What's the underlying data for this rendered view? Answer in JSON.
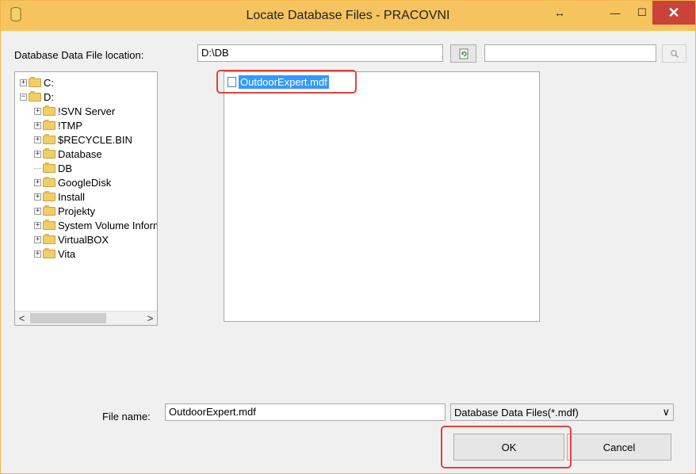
{
  "window": {
    "title": "Locate Database Files - PRACOVNI"
  },
  "titlebar_buttons": {
    "resize": "↔",
    "minimize": "—",
    "maximize": "☐",
    "close": "✕"
  },
  "location": {
    "label": "Database Data File location:",
    "value": "D:\\DB",
    "refresh_icon": "refresh-icon",
    "search_value": "",
    "search_icon": "search-icon"
  },
  "tree": {
    "nodes": [
      {
        "label": "C:",
        "expander": "+"
      },
      {
        "label": "D:",
        "expander": "−"
      },
      {
        "label": "!SVN Server",
        "expander": "+"
      },
      {
        "label": "!TMP",
        "expander": "+"
      },
      {
        "label": "$RECYCLE.BIN",
        "expander": "+"
      },
      {
        "label": "Database",
        "expander": "+"
      },
      {
        "label": "DB",
        "expander": ""
      },
      {
        "label": "GoogleDisk",
        "expander": "+"
      },
      {
        "label": "Install",
        "expander": "+"
      },
      {
        "label": "Projekty",
        "expander": "+"
      },
      {
        "label": "System Volume Information",
        "expander": "+"
      },
      {
        "label": "VirtualBOX",
        "expander": "+"
      },
      {
        "label": "Vita",
        "expander": "+"
      }
    ],
    "scroll_left": "<",
    "scroll_right": ">"
  },
  "files": [
    {
      "name": "OutdoorExpert.mdf",
      "selected": true
    }
  ],
  "filename": {
    "label": "File name:",
    "value": "OutdoorExpert.mdf"
  },
  "filetype": {
    "value": "Database Data Files(*.mdf)",
    "arrow": "∨"
  },
  "buttons": {
    "ok": "OK",
    "cancel": "Cancel"
  }
}
